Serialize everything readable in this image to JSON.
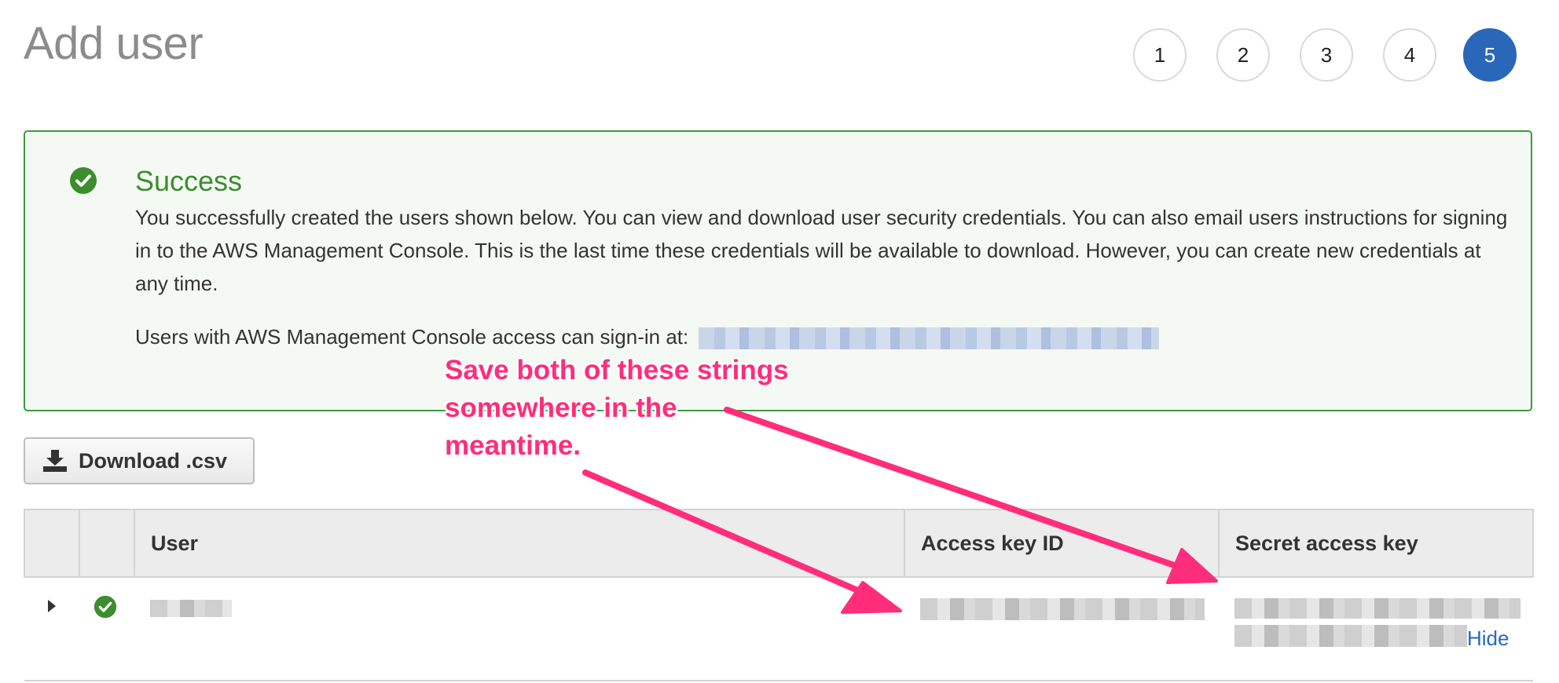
{
  "page": {
    "title": "Add user"
  },
  "steps": [
    {
      "label": "1",
      "active": false
    },
    {
      "label": "2",
      "active": false
    },
    {
      "label": "3",
      "active": false
    },
    {
      "label": "4",
      "active": false
    },
    {
      "label": "5",
      "active": true
    }
  ],
  "success": {
    "icon": "check-circle-icon",
    "title": "Success",
    "message": "You successfully created the users shown below. You can view and download user security credentials. You can also email users instructions for signing in to the AWS Management Console. This is the last time these credentials will be available to download. However, you can create new credentials at any time.",
    "signin_label": "Users with AWS Management Console access can sign-in at:"
  },
  "download_button": {
    "icon": "download-icon",
    "label": "Download .csv"
  },
  "table": {
    "columns": [
      "",
      "",
      "User",
      "Access key ID",
      "Secret access key"
    ],
    "rows": [
      {
        "expand_icon": "triangle-right-icon",
        "status_icon": "check-circle-icon",
        "hide_label": "Hide"
      }
    ]
  },
  "annotation": {
    "lines": [
      "Save both of these strings",
      "somewhere in the",
      "meantime."
    ],
    "color": "#ff2d7a"
  },
  "colors": {
    "accent": "#2a67b9",
    "success": "#3b8d2e",
    "annotation": "#ff2d7a"
  }
}
